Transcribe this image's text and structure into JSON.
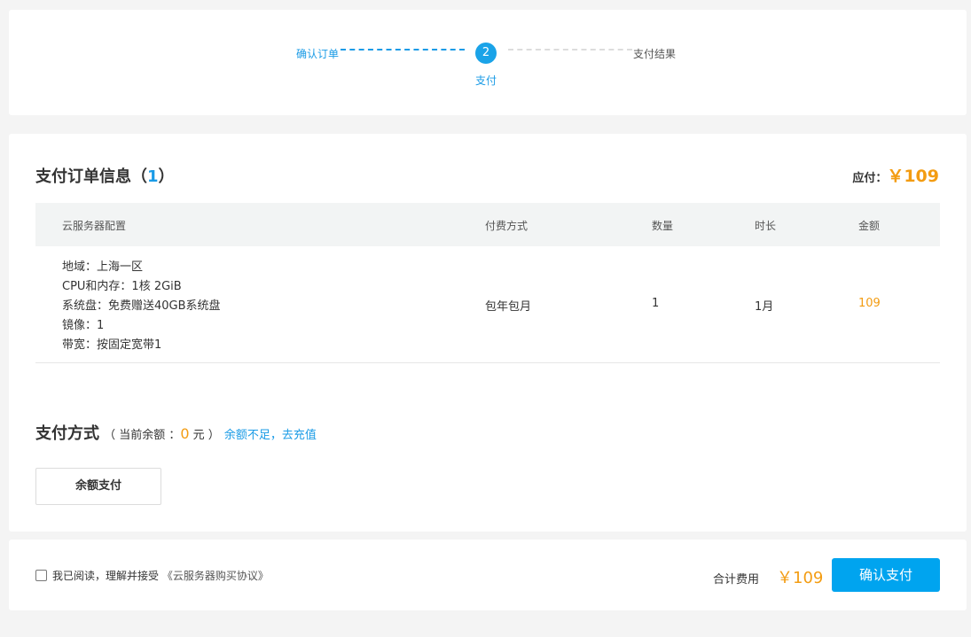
{
  "steps": {
    "step1_label": "确认订单",
    "step2_number": "2",
    "step2_label": "支付",
    "step3_label": "支付结果"
  },
  "order": {
    "title": "支付订单信息（",
    "count": "1",
    "title_close": "）",
    "due_label": "应付：",
    "due_amount": "￥109",
    "table": {
      "headers": {
        "config": "云服务器配置",
        "billing": "付费方式",
        "quantity": "数量",
        "duration": "时长",
        "amount": "金额"
      },
      "row": {
        "specs": [
          "地域：上海一区",
          "CPU和内存：1核 2GiB",
          "系统盘：免费赠送40GB系统盘",
          "镜像：1",
          "带宽：按固定宽带1"
        ],
        "billing": "包年包月",
        "quantity": "1",
        "duration": "1月",
        "amount": "109"
      }
    }
  },
  "payment": {
    "heading": "支付方式",
    "balance_prefix": "（ 当前余额 ：",
    "balance_value": "0",
    "balance_suffix": " 元 ）",
    "recharge_link": "余额不足，去充值",
    "balance_pay_button": "余额支付"
  },
  "footer": {
    "agree_text": "我已阅读，理解并接受",
    "agreement_link": "《云服务器购买协议》",
    "total_label": "合计费用",
    "total_amount": "￥109",
    "confirm_button": "确认支付"
  },
  "colors": {
    "accent": "#1a9be6",
    "price": "#f39c12",
    "confirm_button": "#00a4ef"
  }
}
